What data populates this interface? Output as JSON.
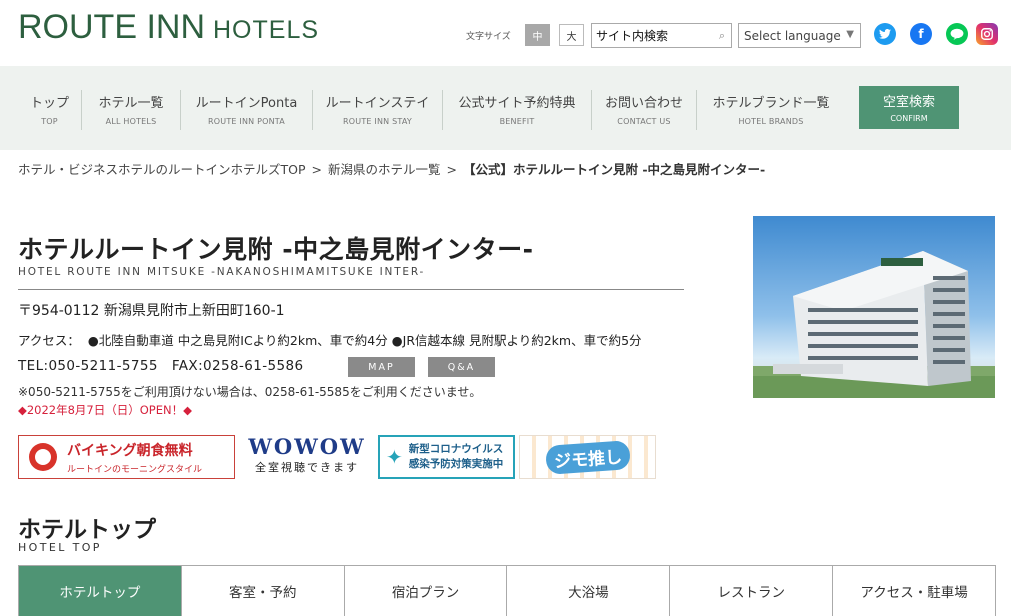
{
  "header": {
    "logo_main": "ROUTE INN",
    "logo_sub": "HOTELS",
    "font_size_label": "文字サイズ",
    "font_size_medium": "中",
    "font_size_large": "大",
    "search_value": "サイト内検索",
    "language_select": "Select language",
    "social": [
      "twitter-icon",
      "facebook-icon",
      "line-icon",
      "instagram-icon"
    ]
  },
  "nav": {
    "items": [
      {
        "jp": "トップ",
        "en": "TOP"
      },
      {
        "jp": "ホテル一覧",
        "en": "ALL HOTELS"
      },
      {
        "jp": "ルートインPonta",
        "en": "ROUTE INN PONTA"
      },
      {
        "jp": "ルートインステイ",
        "en": "ROUTE INN STAY"
      },
      {
        "jp": "公式サイト予約特典",
        "en": "BENEFIT"
      },
      {
        "jp": "お問い合わせ",
        "en": "CONTACT US"
      },
      {
        "jp": "ホテルブランド一覧",
        "en": "HOTEL BRANDS"
      }
    ],
    "cta": {
      "jp": "空室検索",
      "en": "CONFIRM"
    }
  },
  "breadcrumb": {
    "items": [
      "ホテル・ビジネスホテルのルートインホテルズTOP",
      "新潟県のホテル一覧"
    ],
    "separator": ">",
    "current": "【公式】ホテルルートイン見附 -中之島見附インター-"
  },
  "hotel": {
    "title": "ホテルルートイン見附 -中之島見附インター-",
    "title_en": "HOTEL ROUTE INN MITSUKE -NAKANOSHIMAMITSUKE INTER-",
    "address": "〒954-0112 新潟県見附市上新田町160-1",
    "access_label": "アクセス：",
    "access_text": "●北陸自動車道 中之島見附ICより約2km、車で約4分 ●JR信越本線 見附駅より約2km、車で約5分",
    "tel": "TEL:050-5211-5755",
    "fax": "FAX:0258-61-5586",
    "map_label": "MAP",
    "qa_label": "Q&A",
    "notice": "※050-5211-5755をご利用頂けない場合は、0258-61-5585をご利用くださいませ。",
    "opening": "◆2022年8月7日（日）OPEN！◆"
  },
  "banners": {
    "buffet_title": "バイキング朝食無料",
    "buffet_sub": "ルートインのモーニングスタイル",
    "wowow_title": "WOWOW",
    "wowow_sub": "全室視聴できます",
    "corona_line1": "新型コロナウイルス",
    "corona_line2": "感染予防対策実施中",
    "jimo_title": "ジモ推し"
  },
  "section": {
    "title": "ホテルトップ",
    "title_en": "HOTEL TOP"
  },
  "tabs": [
    {
      "label": "ホテルトップ",
      "active": true
    },
    {
      "label": "客室・予約",
      "active": false
    },
    {
      "label": "宿泊プラン",
      "active": false
    },
    {
      "label": "大浴場",
      "active": false
    },
    {
      "label": "レストラン",
      "active": false
    },
    {
      "label": "アクセス・駐車場",
      "active": false
    }
  ],
  "colors": {
    "brand_green": "#2d5f3f",
    "accent_green": "#4f9474",
    "nav_bg": "#eef2ef",
    "opening_red": "#d6213c"
  }
}
